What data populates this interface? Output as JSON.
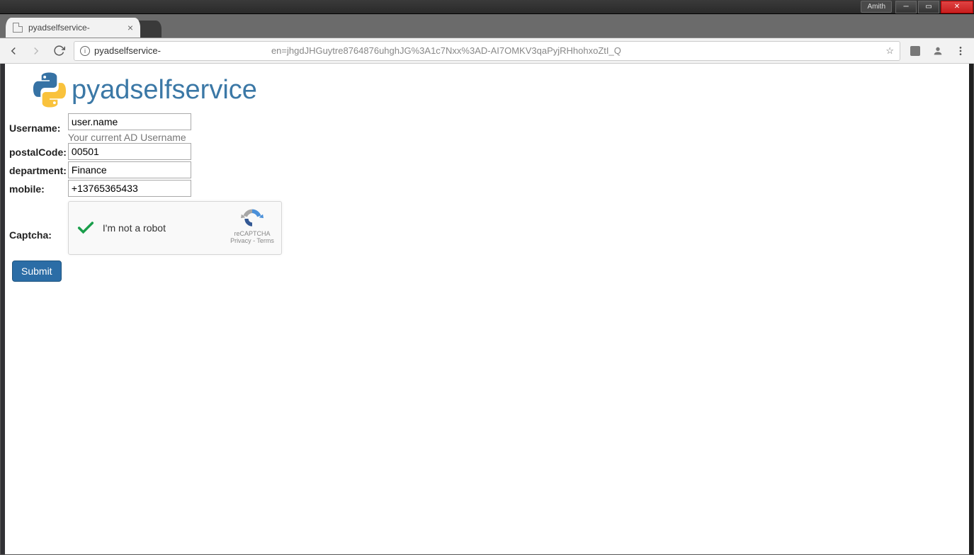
{
  "window": {
    "user_badge": "Amith"
  },
  "browser": {
    "tab_title": "pyadselfservice-",
    "url_host": "pyadselfservice-",
    "url_rest": "en=jhgdJHGuytre8764876uhghJG%3A1c7Nxx%3AD-AI7OMKV3qaPyjRHhohxoZtI_Q"
  },
  "app": {
    "title": "pyadselfservice"
  },
  "form": {
    "username_label": "Username:",
    "username_value": "user.name",
    "username_help": "Your current AD Username",
    "postal_label": "postalCode:",
    "postal_value": "00501",
    "department_label": "department:",
    "department_value": "Finance",
    "mobile_label": "mobile:",
    "mobile_value": "+13765365433",
    "captcha_label": "Captcha:",
    "recaptcha_text": "I'm not a robot",
    "recaptcha_brand": "reCAPTCHA",
    "recaptcha_links": "Privacy - Terms",
    "submit": "Submit"
  }
}
